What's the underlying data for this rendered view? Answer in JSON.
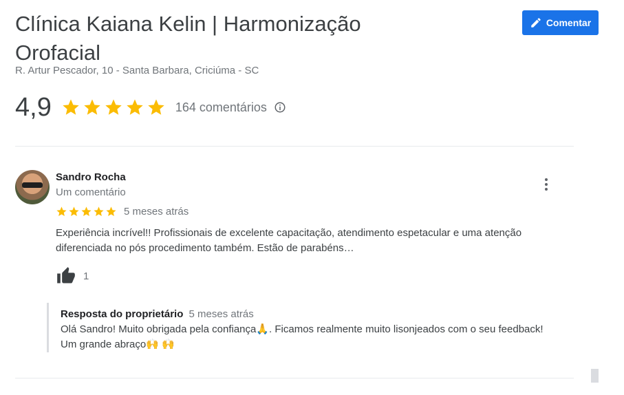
{
  "place": {
    "name": "Clínica Kaiana Kelin | Harmonização Orofacial",
    "address": "R. Artur Pescador, 10 - Santa Barbara, Criciúma - SC",
    "rating": "4,9",
    "stars": 5,
    "review_count": "164 comentários"
  },
  "actions": {
    "comment_label": "Comentar"
  },
  "review": {
    "author": "Sandro Rocha",
    "author_meta": "Um comentário",
    "stars": 5,
    "time": "5 meses atrás",
    "text": "Experiência incrível!! Profissionais de excelente capacitação, atendimento espetacular e uma atenção diferenciada no pós procedimento também. Estão de parabéns…",
    "likes": "1",
    "owner_reply": {
      "label": "Resposta do proprietário",
      "time": "5 meses atrás",
      "text": "Olá Sandro! Muito obrigada pela confiança🙏. Ficamos realmente muito lisonjeados com o seu feedback! Um grande abraço🙌 🙌"
    }
  },
  "colors": {
    "accent": "#1a73e8",
    "star": "#fbbc04",
    "muted": "#70757a"
  },
  "icons": [
    "pencil-icon",
    "star-icon",
    "info-icon",
    "more-vert-icon",
    "thumb-up-icon"
  ]
}
